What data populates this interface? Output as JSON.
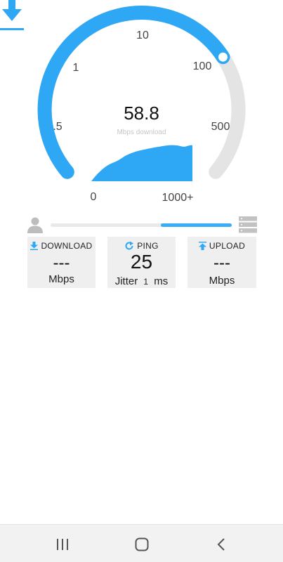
{
  "gauge": {
    "ticks": [
      "0",
      ".5",
      "1",
      "10",
      "100",
      "500",
      "1000+"
    ],
    "speed_value": "58.8",
    "speed_unit": "Mbps download",
    "fill_fraction": 0.72,
    "colors": {
      "fill": "#2ea7f4",
      "track": "#e4e4e4"
    }
  },
  "progress": {
    "fill_fraction": 0.39
  },
  "cards": {
    "download": {
      "label": "DOWNLOAD",
      "value": "---",
      "unit": "Mbps",
      "icon": "download-icon"
    },
    "ping": {
      "label": "PING",
      "value": "25",
      "jitter_label": "Jitter",
      "jitter_value": "1",
      "jitter_unit": "ms",
      "icon": "refresh-icon"
    },
    "upload": {
      "label": "UPLOAD",
      "value": "---",
      "unit": "Mbps",
      "icon": "upload-icon"
    }
  },
  "nav": {
    "icons": [
      "recent-apps-icon",
      "home-icon",
      "back-icon"
    ]
  }
}
